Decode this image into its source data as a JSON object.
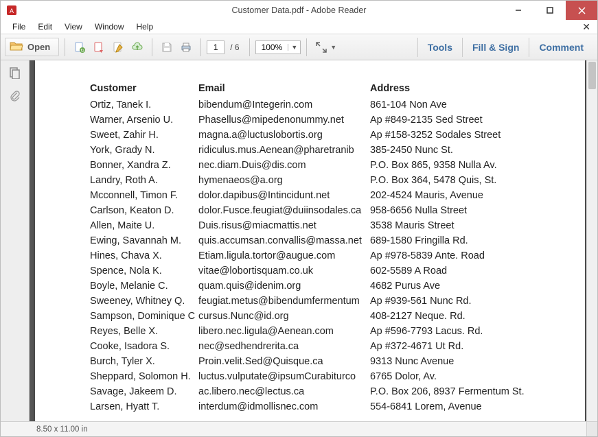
{
  "window": {
    "title": "Customer Data.pdf - Adobe Reader"
  },
  "menu": {
    "file": "File",
    "edit": "Edit",
    "view": "View",
    "window": "Window",
    "help": "Help"
  },
  "toolbar": {
    "open": "Open",
    "page_current": "1",
    "page_total": "/ 6",
    "zoom": "100%",
    "tools": "Tools",
    "fill_sign": "Fill & Sign",
    "comment": "Comment"
  },
  "status": {
    "page_size": "8.50 x 11.00 in"
  },
  "headers": {
    "customer": "Customer",
    "email": "Email",
    "address": "Address"
  },
  "rows": [
    {
      "customer": "Ortiz, Tanek I.",
      "email": "bibendum@Integerin.com",
      "address": "861-104 Non Ave"
    },
    {
      "customer": "Warner, Arsenio U.",
      "email": "Phasellus@mipedenonummy.net",
      "address": "Ap #849-2135 Sed Street"
    },
    {
      "customer": "Sweet, Zahir H.",
      "email": "magna.a@luctuslobortis.org",
      "address": "Ap #158-3252 Sodales Street"
    },
    {
      "customer": "York, Grady N.",
      "email": "ridiculus.mus.Aenean@pharetranib",
      "address": "385-2450 Nunc St."
    },
    {
      "customer": "Bonner, Xandra Z.",
      "email": "nec.diam.Duis@dis.com",
      "address": "P.O. Box 865, 9358 Nulla Av."
    },
    {
      "customer": "Landry, Roth A.",
      "email": "hymenaeos@a.org",
      "address": "P.O. Box 364, 5478 Quis, St."
    },
    {
      "customer": "Mcconnell, Timon F.",
      "email": "dolor.dapibus@Intincidunt.net",
      "address": "202-4524 Mauris, Avenue"
    },
    {
      "customer": "Carlson, Keaton D.",
      "email": "dolor.Fusce.feugiat@duiinsodales.ca",
      "address": "958-6656 Nulla Street"
    },
    {
      "customer": "Allen, Maite U.",
      "email": "Duis.risus@miacmattis.net",
      "address": "3538 Mauris Street"
    },
    {
      "customer": "Ewing, Savannah M.",
      "email": "quis.accumsan.convallis@massa.net",
      "address": "689-1580 Fringilla Rd."
    },
    {
      "customer": "Hines, Chava X.",
      "email": "Etiam.ligula.tortor@augue.com",
      "address": "Ap #978-5839 Ante. Road"
    },
    {
      "customer": "Spence, Nola K.",
      "email": "vitae@lobortisquam.co.uk",
      "address": "602-5589 A Road"
    },
    {
      "customer": "Boyle, Melanie C.",
      "email": "quam.quis@idenim.org",
      "address": "4682 Purus Ave"
    },
    {
      "customer": "Sweeney, Whitney Q.",
      "email": "feugiat.metus@bibendumfermentum",
      "address": "Ap #939-561 Nunc Rd."
    },
    {
      "customer": "Sampson, Dominique C",
      "email": "cursus.Nunc@id.org",
      "address": "408-2127 Neque. Rd."
    },
    {
      "customer": "Reyes, Belle X.",
      "email": "libero.nec.ligula@Aenean.com",
      "address": "Ap #596-7793 Lacus. Rd."
    },
    {
      "customer": "Cooke, Isadora S.",
      "email": "nec@sedhendrerita.ca",
      "address": "Ap #372-4671 Ut Rd."
    },
    {
      "customer": "Burch, Tyler X.",
      "email": "Proin.velit.Sed@Quisque.ca",
      "address": "9313 Nunc Avenue"
    },
    {
      "customer": "Sheppard, Solomon H.",
      "email": "luctus.vulputate@ipsumCurabiturco",
      "address": "6765 Dolor, Av."
    },
    {
      "customer": "Savage, Jakeem D.",
      "email": "ac.libero.nec@lectus.ca",
      "address": "P.O. Box 206, 8937 Fermentum St."
    },
    {
      "customer": "Larsen, Hyatt T.",
      "email": "interdum@idmollisnec.com",
      "address": "554-6841 Lorem, Avenue"
    }
  ]
}
